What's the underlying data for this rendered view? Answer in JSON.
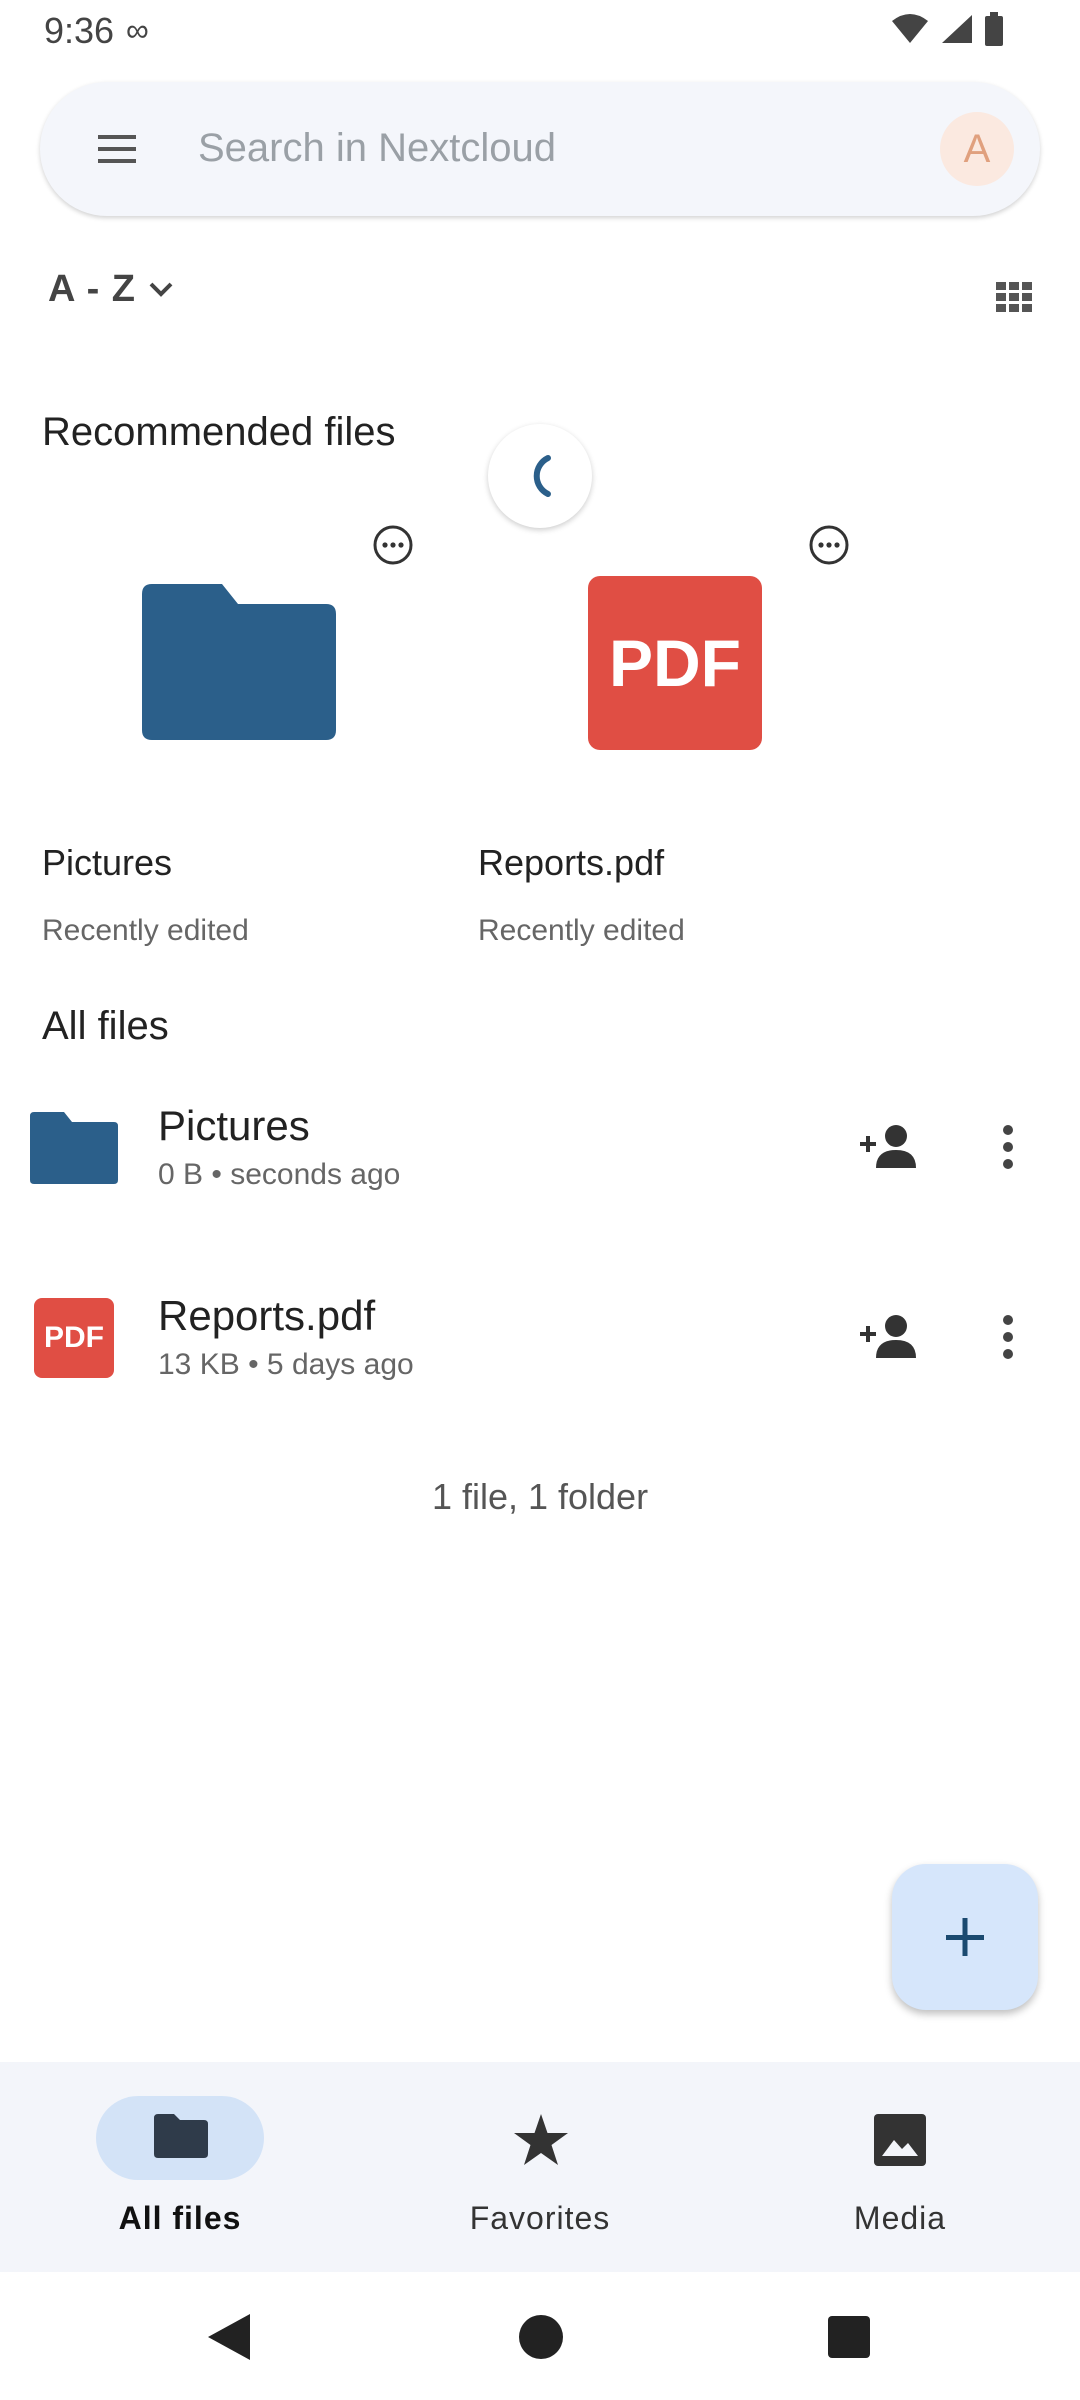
{
  "status_bar": {
    "time": "9:36",
    "infinity": "∞"
  },
  "search": {
    "placeholder": "Search in Nextcloud",
    "avatar_letter": "A"
  },
  "sort": {
    "label": "A - Z"
  },
  "recommended": {
    "title": "Recommended files",
    "items": [
      {
        "name": "Pictures",
        "subtitle": "Recently edited",
        "type": "folder"
      },
      {
        "name": "Reports.pdf",
        "subtitle": "Recently edited",
        "type": "pdf"
      }
    ]
  },
  "all_files": {
    "title": "All files",
    "items": [
      {
        "name": "Pictures",
        "size": "0 B",
        "modified": "seconds ago",
        "type": "folder"
      },
      {
        "name": "Reports.pdf",
        "size": "13 KB",
        "modified": "5 days ago",
        "type": "pdf"
      }
    ],
    "summary": "1 file, 1 folder"
  },
  "pdf_label": "PDF",
  "bottom_nav": [
    {
      "label": "All files",
      "icon": "folder-icon",
      "active": true
    },
    {
      "label": "Favorites",
      "icon": "star-icon",
      "active": false
    },
    {
      "label": "Media",
      "icon": "image-icon",
      "active": false
    }
  ],
  "colors": {
    "folder": "#2b5f8a",
    "pdf": "#e04e44",
    "accent": "#d3e3f7",
    "fab": "#d6e6fb"
  }
}
